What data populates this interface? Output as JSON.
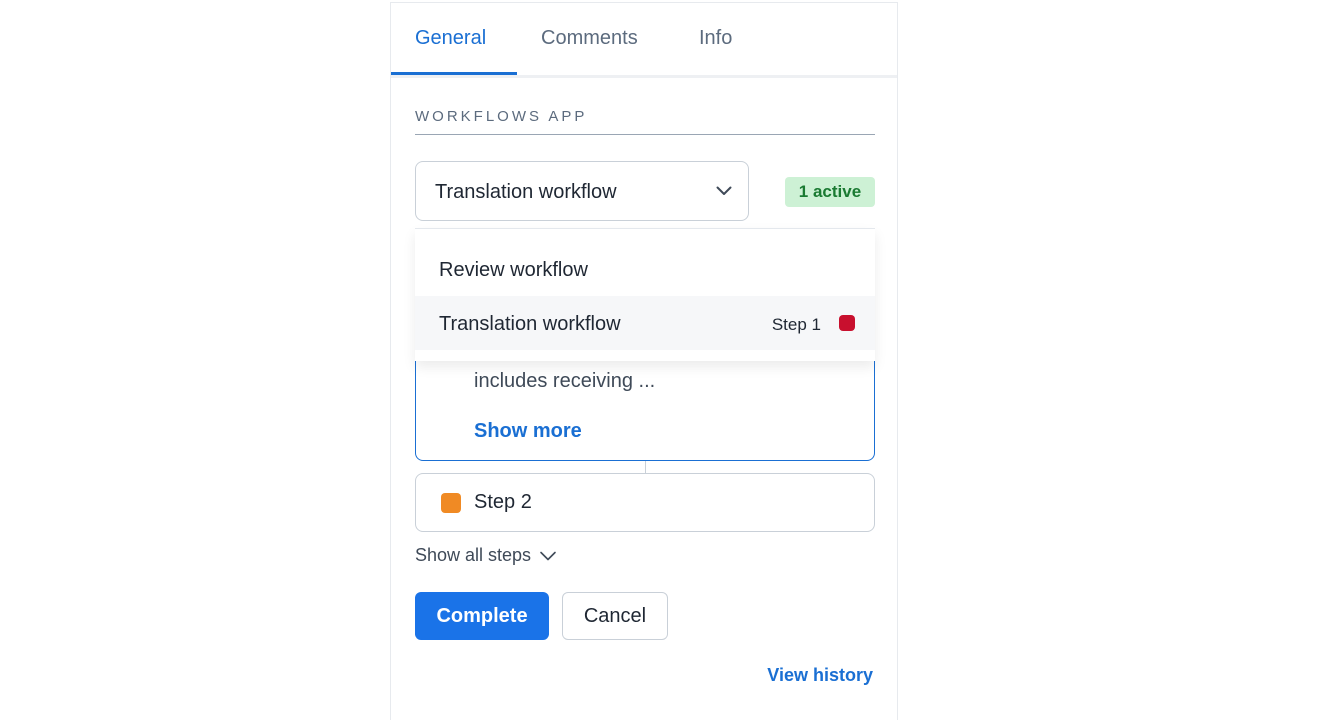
{
  "tabs": [
    {
      "label": "General",
      "active": true
    },
    {
      "label": "Comments",
      "active": false
    },
    {
      "label": "Info",
      "active": false
    }
  ],
  "section": {
    "heading": "WORKFLOWS APP"
  },
  "workflow_select": {
    "value": "Translation workflow",
    "icon": "chevron-down-icon"
  },
  "status_badge": {
    "text": "1 active",
    "color": "#1a7a32",
    "background": "#cdf1d5"
  },
  "dropdown": {
    "items": [
      {
        "label": "Review workflow",
        "selected": false
      },
      {
        "label": "Translation workflow",
        "step": "Step 1",
        "selected": true,
        "status_color": "#c8102e"
      }
    ]
  },
  "active_step": {
    "description": "includes receiving ...",
    "show_more_label": "Show more"
  },
  "next_step": {
    "label": "Step 2",
    "status_color": "#f08a24"
  },
  "show_all_steps": {
    "label": "Show all steps",
    "icon": "chevron-down-icon"
  },
  "actions": {
    "complete_label": "Complete",
    "cancel_label": "Cancel"
  },
  "footer": {
    "view_history_label": "View history"
  },
  "colors": {
    "accent": "#1a6fd3",
    "primary_button": "#1a73e8"
  }
}
